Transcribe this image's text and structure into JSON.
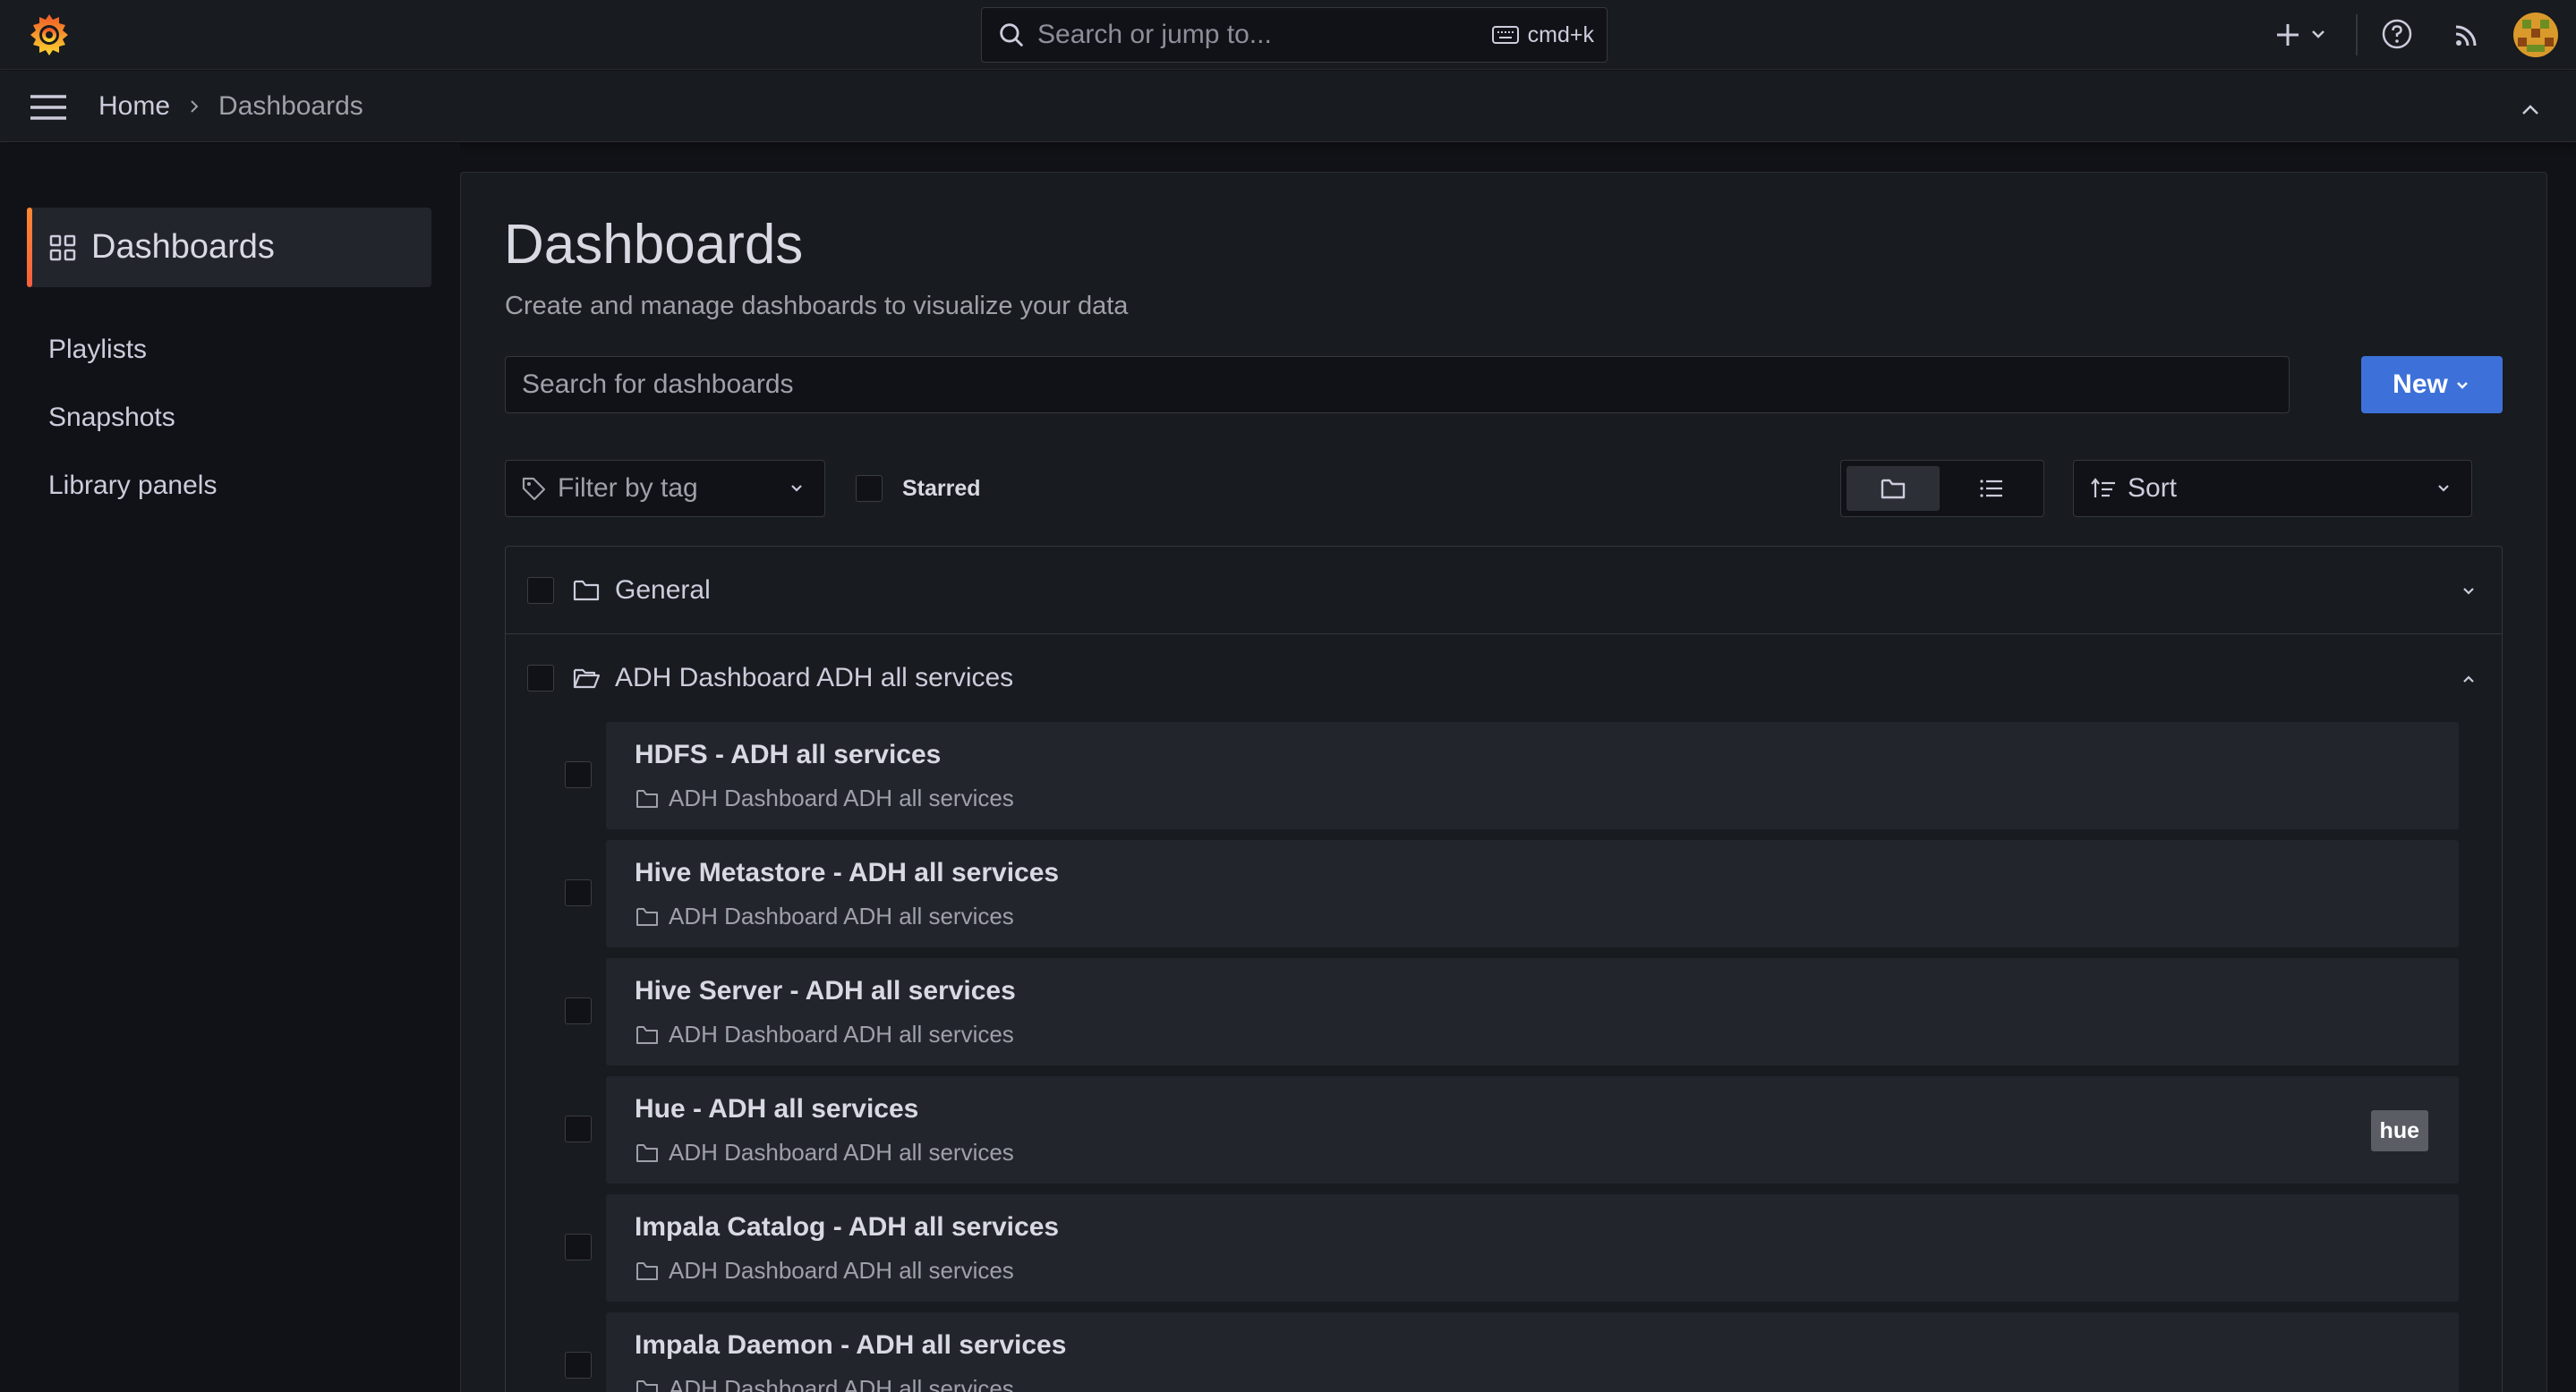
{
  "header": {
    "search_placeholder": "Search or jump to...",
    "search_shortcut": "cmd+k",
    "accent_color": "#f55f3e"
  },
  "breadcrumb": {
    "home": "Home",
    "current": "Dashboards"
  },
  "sidebar": {
    "section_title": "Dashboards",
    "items": [
      {
        "label": "Playlists"
      },
      {
        "label": "Snapshots"
      },
      {
        "label": "Library panels"
      }
    ]
  },
  "page": {
    "title": "Dashboards",
    "subtitle": "Create and manage dashboards to visualize your data",
    "search_placeholder": "Search for dashboards",
    "new_button": "New",
    "primary_color": "#3d71d9"
  },
  "filters": {
    "tag_placeholder": "Filter by tag",
    "starred_label": "Starred",
    "sort_label": "Sort",
    "view_mode": "folders"
  },
  "folders": [
    {
      "name": "General",
      "expanded": false
    },
    {
      "name": "ADH Dashboard ADH all services",
      "expanded": true
    }
  ],
  "dashboards": [
    {
      "title": "HDFS - ADH all services",
      "location": "ADH Dashboard ADH all services",
      "tag": ""
    },
    {
      "title": "Hive Metastore - ADH all services",
      "location": "ADH Dashboard ADH all services",
      "tag": ""
    },
    {
      "title": "Hive Server - ADH all services",
      "location": "ADH Dashboard ADH all services",
      "tag": ""
    },
    {
      "title": "Hue - ADH all services",
      "location": "ADH Dashboard ADH all services",
      "tag": "hue"
    },
    {
      "title": "Impala Catalog - ADH all services",
      "location": "ADH Dashboard ADH all services",
      "tag": ""
    },
    {
      "title": "Impala Daemon - ADH all services",
      "location": "ADH Dashboard ADH all services",
      "tag": ""
    }
  ]
}
